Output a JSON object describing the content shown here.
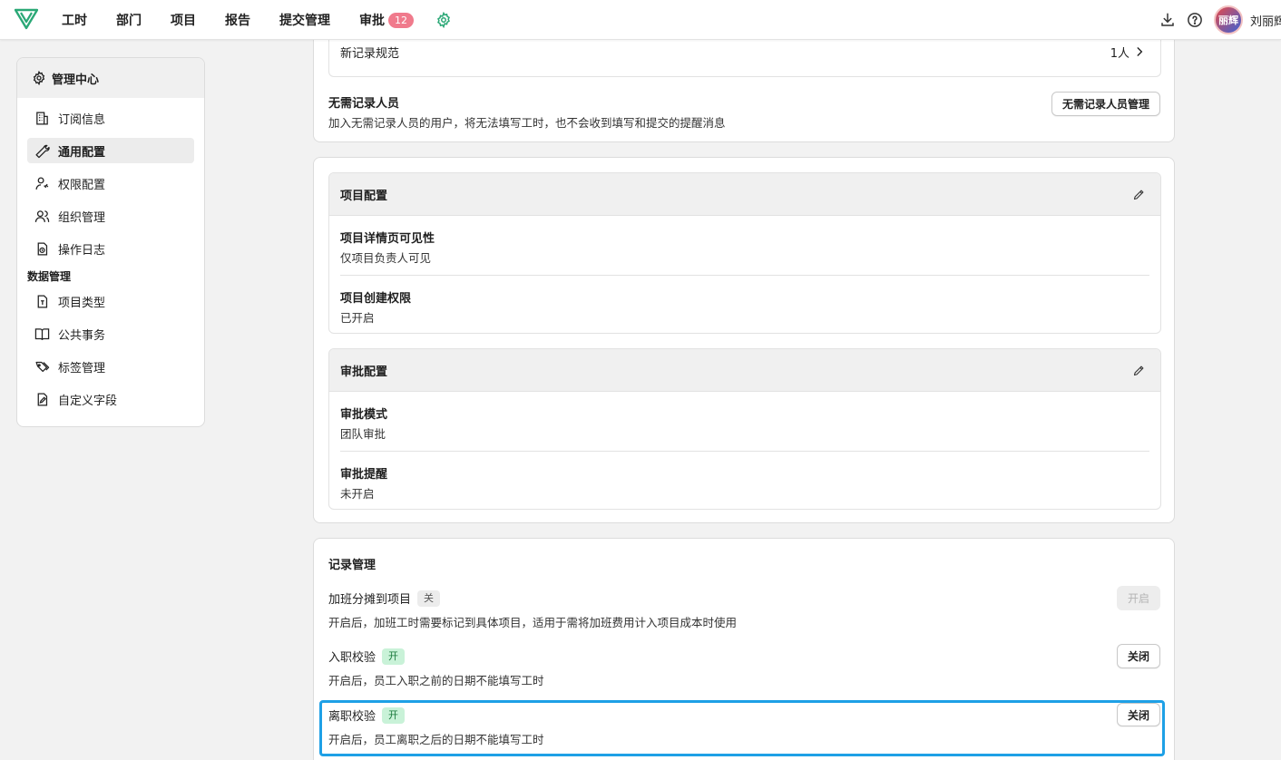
{
  "nav": {
    "items": [
      "工时",
      "部门",
      "项目",
      "报告",
      "提交管理",
      "审批"
    ],
    "approval_badge": "12",
    "user_avatar_text": "丽辉",
    "user_name": "刘丽辉"
  },
  "sidebar": {
    "title": "管理中心",
    "items": [
      "订阅信息",
      "通用配置",
      "权限配置",
      "组织管理",
      "操作日志"
    ],
    "section": "数据管理",
    "data_items": [
      "项目类型",
      "公共事务",
      "标签管理",
      "自定义字段"
    ]
  },
  "record_rules": {
    "rule_label": "新记录规范",
    "rule_value": "1人",
    "exempt_title": "无需记录人员",
    "exempt_desc": "加入无需记录人员的用户，将无法填写工时，也不会收到填写和提交的提醒消息",
    "exempt_button": "无需记录人员管理"
  },
  "project_config": {
    "title": "项目配置",
    "items": [
      {
        "label": "项目详情页可见性",
        "value": "仅项目负责人可见"
      },
      {
        "label": "项目创建权限",
        "value": "已开启"
      }
    ]
  },
  "approval_config": {
    "title": "审批配置",
    "items": [
      {
        "label": "审批模式",
        "value": "团队审批"
      },
      {
        "label": "审批提醒",
        "value": "未开启"
      }
    ]
  },
  "record_management": {
    "title": "记录管理",
    "settings": [
      {
        "label": "加班分摊到项目",
        "status": "关",
        "desc": "开启后，加班工时需要标记到具体项目，适用于需将加班费用计入项目成本时使用",
        "button": "开启"
      },
      {
        "label": "入职校验",
        "status": "开",
        "desc": "开启后，员工入职之前的日期不能填写工时",
        "button": "关闭"
      },
      {
        "label": "离职校验",
        "status": "开",
        "desc": "开启后，员工离职之后的日期不能填写工时",
        "button": "关闭"
      }
    ]
  },
  "colors": {
    "accent": "#1ea0e6",
    "badge": "#f07a8c",
    "on_tag": "#c9f2d8",
    "gear": "#2aa876"
  }
}
